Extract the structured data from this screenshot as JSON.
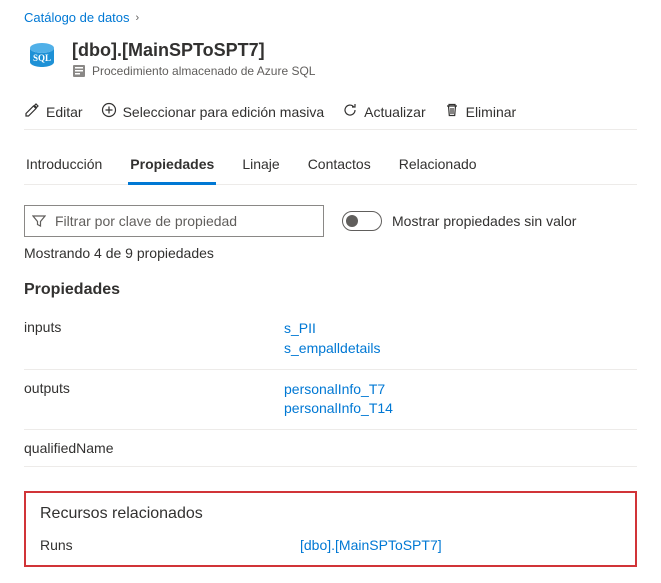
{
  "breadcrumb": {
    "root": "Catálogo de datos"
  },
  "header": {
    "title": "[dbo].[MainSPToSPT7]",
    "subtitle": "Procedimiento almacenado de Azure SQL"
  },
  "toolbar": {
    "edit": "Editar",
    "bulk": "Seleccionar para edición masiva",
    "refresh": "Actualizar",
    "delete": "Eliminar"
  },
  "tabs": {
    "intro": "Introducción",
    "props": "Propiedades",
    "lineage": "Linaje",
    "contacts": "Contactos",
    "related": "Relacionado"
  },
  "filter": {
    "placeholder": "Filtrar por clave de propiedad"
  },
  "toggle": {
    "label": "Mostrar propiedades sin valor"
  },
  "count": "Mostrando 4 de 9 propiedades",
  "sections": {
    "props_title": "Propiedades",
    "related_title": "Recursos relacionados"
  },
  "props": {
    "inputs": {
      "key": "inputs",
      "vals": [
        "s_PII",
        "s_empalldetails"
      ]
    },
    "outputs": {
      "key": "outputs",
      "vals": [
        "personalInfo_T7",
        "personalInfo_T14"
      ]
    },
    "qualifiedName": {
      "key": "qualifiedName",
      "vals": []
    }
  },
  "related": {
    "runs": {
      "key": "Runs",
      "val": "[dbo].[MainSPToSPT7]"
    }
  }
}
